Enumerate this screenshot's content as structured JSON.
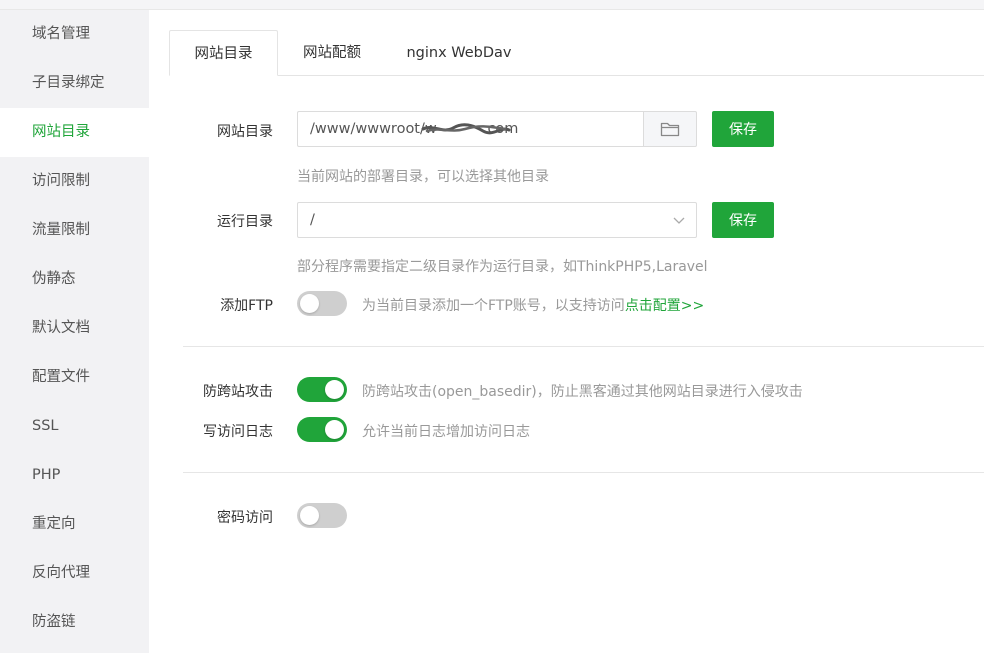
{
  "sidebar": {
    "items": [
      {
        "label": "域名管理",
        "active": false
      },
      {
        "label": "子目录绑定",
        "active": false
      },
      {
        "label": "网站目录",
        "active": true
      },
      {
        "label": "访问限制",
        "active": false
      },
      {
        "label": "流量限制",
        "active": false
      },
      {
        "label": "伪静态",
        "active": false
      },
      {
        "label": "默认文档",
        "active": false
      },
      {
        "label": "配置文件",
        "active": false
      },
      {
        "label": "SSL",
        "active": false
      },
      {
        "label": "PHP",
        "active": false
      },
      {
        "label": "重定向",
        "active": false
      },
      {
        "label": "反向代理",
        "active": false
      },
      {
        "label": "防盗链",
        "active": false
      }
    ]
  },
  "tabs": [
    {
      "label": "网站目录",
      "active": true
    },
    {
      "label": "网站配额",
      "active": false
    },
    {
      "label": "nginx WebDav",
      "active": false
    }
  ],
  "site_dir": {
    "label": "网站目录",
    "value": "/www/wwwroot/w          .com",
    "hint": "当前网站的部署目录，可以选择其他目录",
    "folder_icon": "folder-icon",
    "save_label": "保存"
  },
  "run_dir": {
    "label": "运行目录",
    "value": "/",
    "hint": "部分程序需要指定二级目录作为运行目录，如ThinkPHP5,Laravel",
    "save_label": "保存"
  },
  "ftp": {
    "label": "添加FTP",
    "enabled": false,
    "hint": "为当前目录添加一个FTP账号，以支持访问",
    "link": "点击配置>>"
  },
  "anti_xss": {
    "label": "防跨站攻击",
    "enabled": true,
    "hint": "防跨站攻击(open_basedir)，防止黑客通过其他网站目录进行入侵攻击"
  },
  "access_log": {
    "label": "写访问日志",
    "enabled": true,
    "hint": "允许当前日志增加访问日志"
  },
  "password_access": {
    "label": "密码访问",
    "enabled": false
  },
  "colors": {
    "accent": "#20a53a",
    "sidebar_bg": "#f2f2f4",
    "toggle_off": "#cfcfcf"
  }
}
